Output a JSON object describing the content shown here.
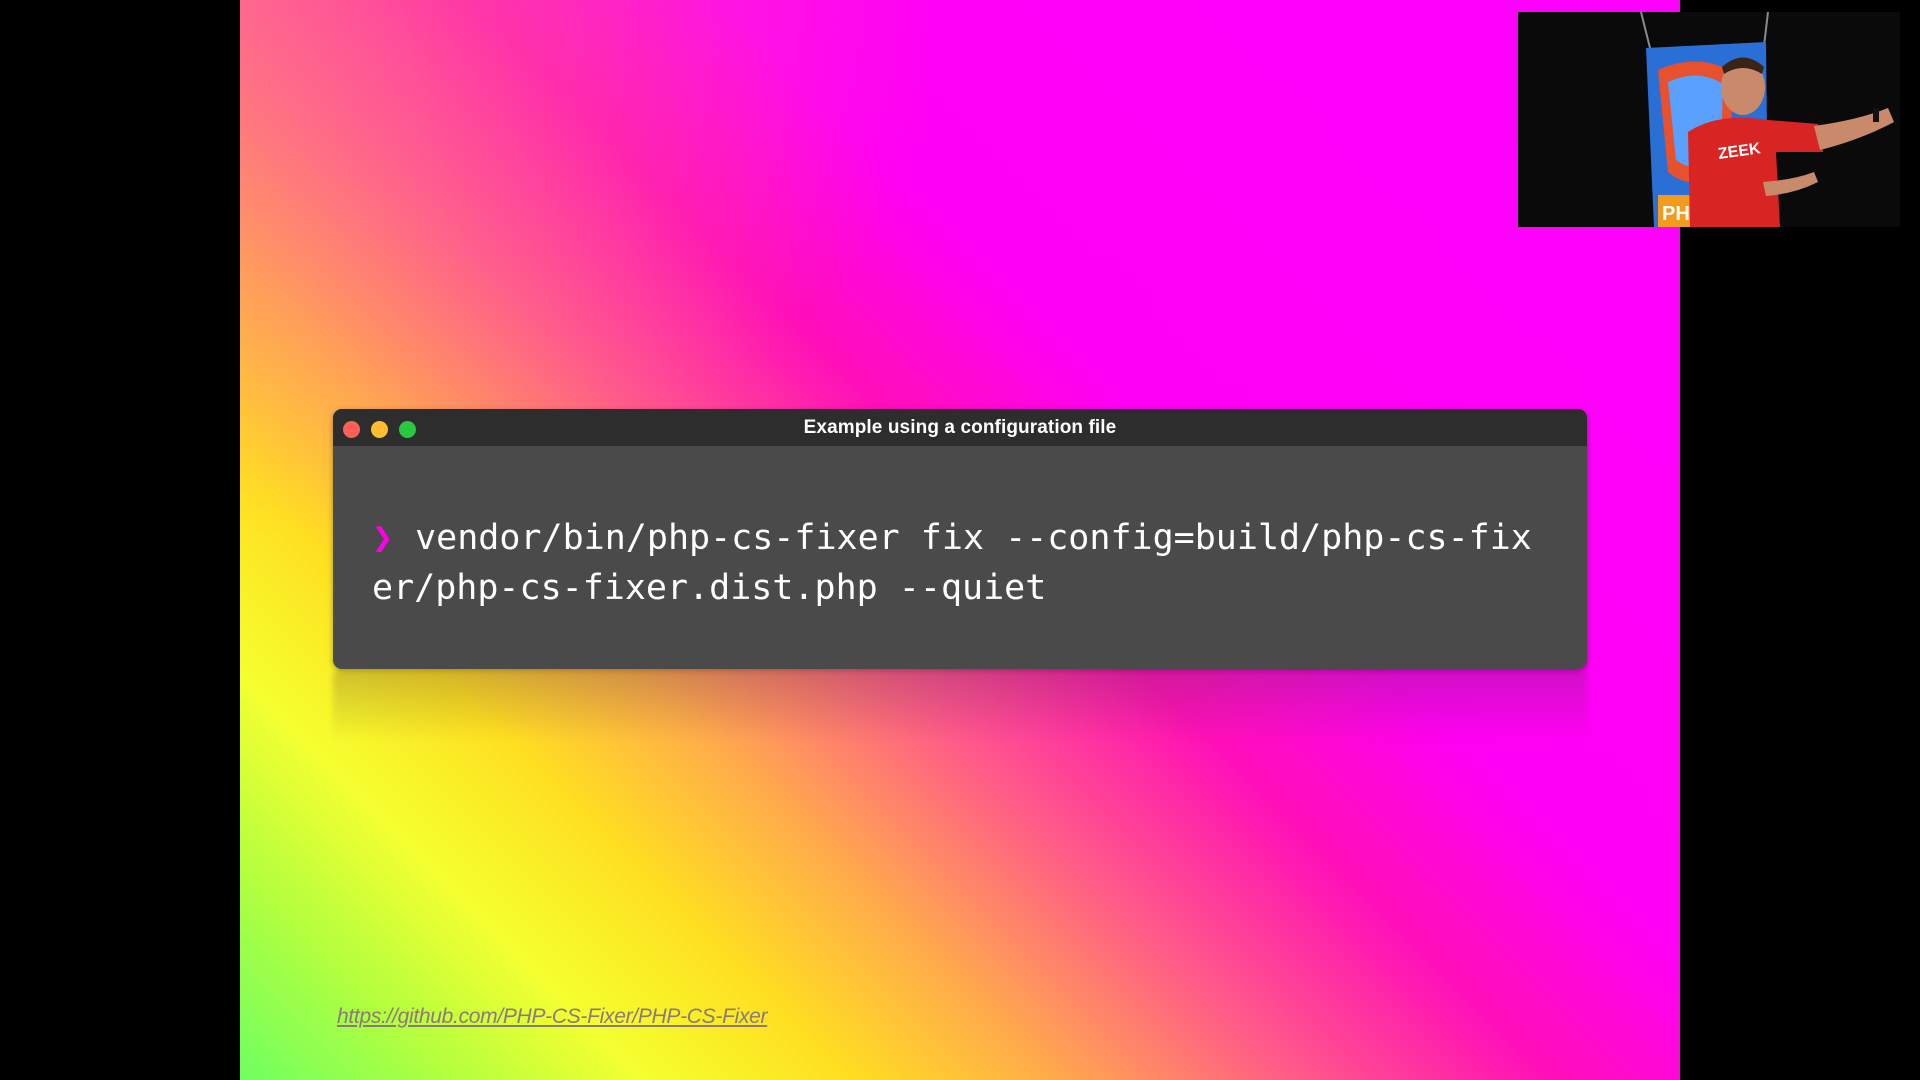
{
  "terminal": {
    "title": "Example using a configuration file",
    "prompt_symbol": "❯",
    "command": "vendor/bin/php-cs-fixer fix --config=build/php-cs-fixer/php-cs-fixer.dist.php --quiet"
  },
  "slide": {
    "link_text": "https://github.com/PHP-CS-Fixer/PHP-CS-Fixer"
  },
  "webcam": {
    "shirt_logo": "ZEEK",
    "banner_text": "PH"
  },
  "colors": {
    "prompt": "#ff00e6",
    "terminal_bg": "#4a4a4a",
    "titlebar_bg": "#2d2d2d",
    "close": "#ff5f57",
    "minimize": "#febc2e",
    "maximize": "#28c840"
  }
}
